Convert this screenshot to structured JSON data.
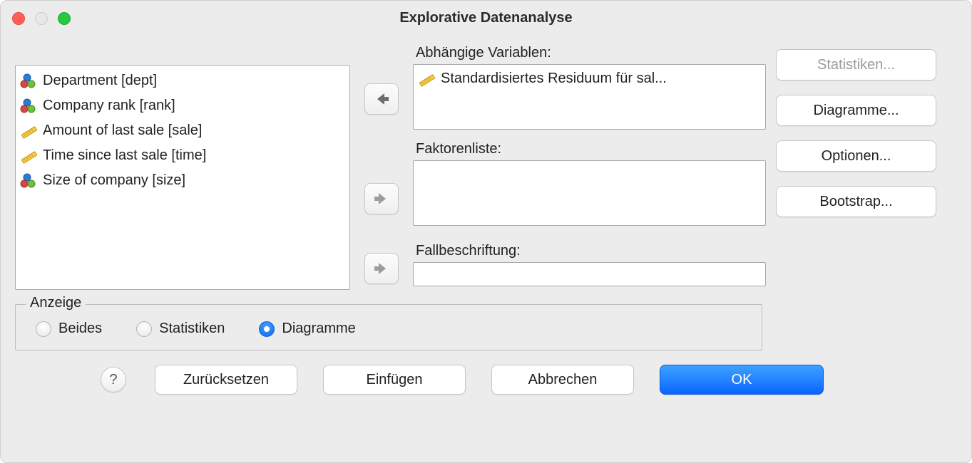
{
  "window": {
    "title": "Explorative Datenanalyse"
  },
  "source_vars": [
    {
      "label": "Department [dept]",
      "icon": "nominal"
    },
    {
      "label": "Company rank [rank]",
      "icon": "nominal"
    },
    {
      "label": "Amount of last sale [sale]",
      "icon": "scale"
    },
    {
      "label": "Time since last sale [time]",
      "icon": "scale"
    },
    {
      "label": "Size of company [size]",
      "icon": "nominal"
    }
  ],
  "sections": {
    "dependent_label": "Abhängige Variablen:",
    "factor_label": "Faktorenliste:",
    "case_label": "Fallbeschriftung:"
  },
  "dependent_vars": [
    {
      "label": "Standardisiertes Residuum für sal...",
      "icon": "scale"
    }
  ],
  "side_buttons": {
    "stats": "Statistiken...",
    "charts": "Diagramme...",
    "options": "Optionen...",
    "bootstrap": "Bootstrap..."
  },
  "anzeige": {
    "legend": "Anzeige",
    "options": {
      "both": "Beides",
      "stats": "Statistiken",
      "charts": "Diagramme"
    },
    "selected": "charts"
  },
  "bottom": {
    "help": "?",
    "reset": "Zurücksetzen",
    "paste": "Einfügen",
    "cancel": "Abbrechen",
    "ok": "OK"
  }
}
